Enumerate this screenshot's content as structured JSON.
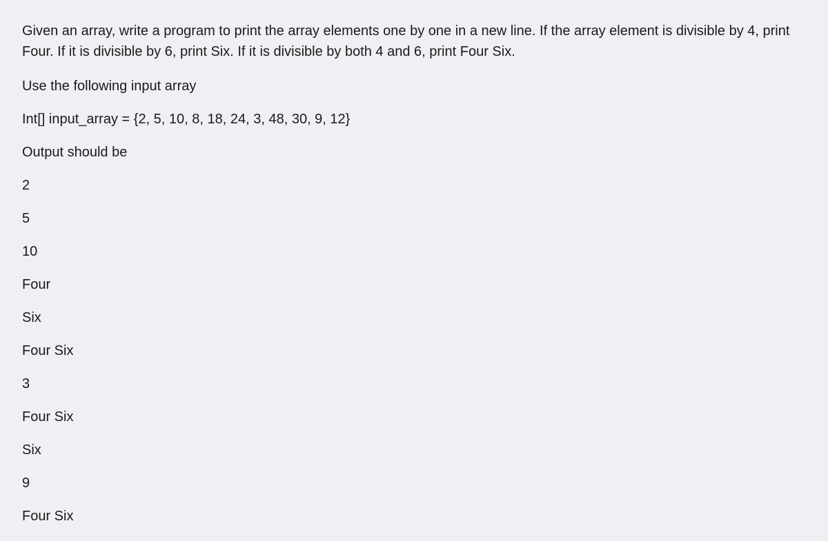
{
  "intro": "Given an array, write a program to print the array elements one by one in a new line. If the array element is divisible by 4, print Four. If it is divisible by 6, print Six. If it is divisible by both 4 and 6, print Four Six.",
  "instruction": "Use the following input array",
  "declaration": "Int[] input_array = {2, 5, 10, 8, 18, 24, 3, 48, 30, 9, 12}",
  "output_label": "Output should be",
  "output_lines": [
    "2",
    "5",
    "10",
    "Four",
    "Six",
    "Four Six",
    "3",
    "Four Six",
    "Six",
    "9",
    "Four Six"
  ]
}
